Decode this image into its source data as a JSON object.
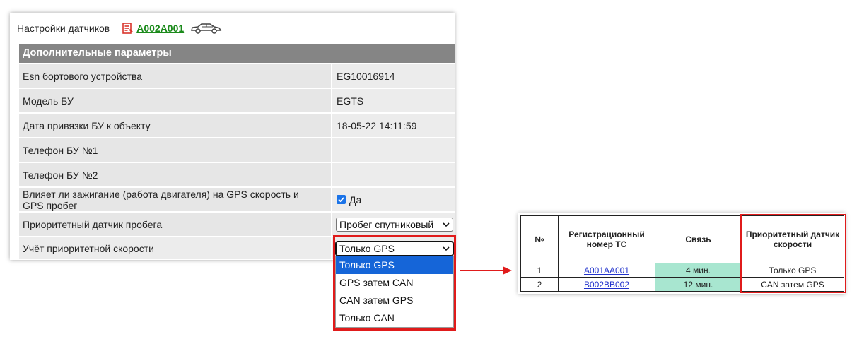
{
  "header": {
    "title": "Настройки датчиков",
    "plate": "А002А001"
  },
  "section": {
    "title": "Дополнительные параметры"
  },
  "rows": [
    {
      "label": "Esn бортового устройства",
      "value": "EG10016914"
    },
    {
      "label": "Модель БУ",
      "value": "EGTS"
    },
    {
      "label": "Дата привязки БУ к объекту",
      "value": "18-05-22 14:11:59"
    },
    {
      "label": "Телефон БУ №1",
      "value": ""
    },
    {
      "label": "Телефон БУ №2",
      "value": ""
    },
    {
      "label": "Влияет ли зажигание (работа двигателя) на GPS скорость и GPS пробег",
      "checkbox_label": "Да",
      "checked": true
    },
    {
      "label": "Приоритетный датчик пробега",
      "select_value": "Пробег спутниковый"
    },
    {
      "label": "Учёт приоритетной скорости",
      "select_value": "Только GPS"
    }
  ],
  "dropdown": {
    "options": [
      "Только GPS",
      "GPS затем CAN",
      "CAN затем GPS",
      "Только CAN"
    ],
    "selected_index": 0
  },
  "table": {
    "headers": [
      "№",
      "Регистрационный номер ТС",
      "Связь",
      "Приоритетный датчик скорости"
    ],
    "rows": [
      {
        "num": "1",
        "plate": "А001АА001",
        "conn": "4 мин.",
        "sensor": "Только GPS"
      },
      {
        "num": "2",
        "plate": "В002ВВ002",
        "conn": "12 мин.",
        "sensor": "CAN затем GPS"
      }
    ]
  },
  "colors": {
    "accent_red": "#e01b1b",
    "header_gray": "#858585",
    "link_green": "#1a8a1a",
    "conn_green": "#a8e6d0",
    "select_blue": "#1565d8"
  }
}
